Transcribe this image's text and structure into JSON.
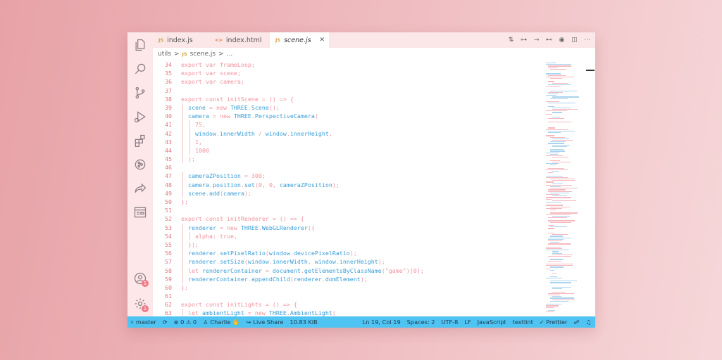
{
  "colors": {
    "accent_statusbar": "#4fc3f2",
    "line_numbers": "#e07a86",
    "keyword": "#f0929c",
    "identifier": "#3b9ed6",
    "activity_bar": "#fde7e9"
  },
  "tabs": [
    {
      "icon": "JS",
      "label": "index.js"
    },
    {
      "icon": "<>",
      "label": "index.html"
    },
    {
      "icon": "JS",
      "label": "scene.js",
      "close": "✕"
    }
  ],
  "breadcrumb": {
    "folder": "utils",
    "sep": ">",
    "icon": "JS",
    "file": "scene.js",
    "more": "..."
  },
  "activity_icons": [
    "files-icon",
    "search-icon",
    "source-control-icon",
    "run-debug-icon",
    "extensions-icon",
    "gitlens-icon",
    "live-share-icon",
    "panel-icon",
    "account-icon",
    "settings-icon"
  ],
  "account_badge": "1",
  "settings_badge": "1",
  "code_lines": [
    {
      "n": "34",
      "t": [
        [
          "k",
          "export var "
        ],
        [
          "n",
          "frameLoop"
        ],
        [
          "k",
          ";"
        ]
      ]
    },
    {
      "n": "35",
      "t": [
        [
          "k",
          "export var "
        ],
        [
          "n",
          "scene"
        ],
        [
          "k",
          ";"
        ]
      ]
    },
    {
      "n": "36",
      "t": [
        [
          "k",
          "export var "
        ],
        [
          "n",
          "camera"
        ],
        [
          "k",
          ";"
        ]
      ]
    },
    {
      "n": "37",
      "t": []
    },
    {
      "n": "38",
      "t": [
        [
          "k",
          "export const "
        ],
        [
          "n",
          "initScene"
        ],
        [
          "k",
          " = () => {"
        ]
      ]
    },
    {
      "n": "39",
      "t": [
        [
          "i",
          "  scene"
        ],
        [
          "k",
          " = new "
        ],
        [
          "i",
          "THREE"
        ],
        [
          "k",
          "."
        ],
        [
          "i",
          "Scene"
        ],
        [
          "k",
          "();"
        ]
      ]
    },
    {
      "n": "40",
      "t": [
        [
          "i",
          "  camera"
        ],
        [
          "k",
          " = new "
        ],
        [
          "i",
          "THREE"
        ],
        [
          "k",
          "."
        ],
        [
          "i",
          "PerspectiveCamera"
        ],
        [
          "k",
          "("
        ]
      ]
    },
    {
      "n": "41",
      "t": [
        [
          "n",
          "    75"
        ],
        [
          "k",
          ","
        ]
      ]
    },
    {
      "n": "42",
      "t": [
        [
          "i",
          "    window"
        ],
        [
          "k",
          "."
        ],
        [
          "i",
          "innerWidth"
        ],
        [
          "k",
          " / "
        ],
        [
          "i",
          "window"
        ],
        [
          "k",
          "."
        ],
        [
          "i",
          "innerHeight"
        ],
        [
          "k",
          ","
        ]
      ]
    },
    {
      "n": "43",
      "t": [
        [
          "n",
          "    1"
        ],
        [
          "k",
          ","
        ]
      ]
    },
    {
      "n": "44",
      "t": [
        [
          "n",
          "    1000"
        ]
      ]
    },
    {
      "n": "45",
      "t": [
        [
          "k",
          "  );"
        ]
      ]
    },
    {
      "n": "46",
      "t": []
    },
    {
      "n": "47",
      "t": [
        [
          "i",
          "  cameraZPosition"
        ],
        [
          "k",
          " = "
        ],
        [
          "n",
          "300"
        ],
        [
          "k",
          ";"
        ]
      ]
    },
    {
      "n": "48",
      "t": [
        [
          "i",
          "  camera"
        ],
        [
          "k",
          "."
        ],
        [
          "i",
          "position"
        ],
        [
          "k",
          "."
        ],
        [
          "i",
          "set"
        ],
        [
          "k",
          "("
        ],
        [
          "n",
          "0"
        ],
        [
          "k",
          ", "
        ],
        [
          "n",
          "0"
        ],
        [
          "k",
          ", "
        ],
        [
          "i",
          "cameraZPosition"
        ],
        [
          "k",
          ");"
        ]
      ]
    },
    {
      "n": "49",
      "t": [
        [
          "i",
          "  scene"
        ],
        [
          "k",
          "."
        ],
        [
          "i",
          "add"
        ],
        [
          "k",
          "("
        ],
        [
          "i",
          "camera"
        ],
        [
          "k",
          ");"
        ]
      ]
    },
    {
      "n": "50",
      "t": [
        [
          "k",
          "};"
        ]
      ]
    },
    {
      "n": "51",
      "t": []
    },
    {
      "n": "52",
      "t": [
        [
          "k",
          "export const "
        ],
        [
          "n",
          "initRenderer"
        ],
        [
          "k",
          " = () => {"
        ]
      ]
    },
    {
      "n": "53",
      "t": [
        [
          "i",
          "  renderer"
        ],
        [
          "k",
          " = new "
        ],
        [
          "i",
          "THREE"
        ],
        [
          "k",
          "."
        ],
        [
          "i",
          "WebGLRenderer"
        ],
        [
          "k",
          "({"
        ]
      ]
    },
    {
      "n": "54",
      "t": [
        [
          "n",
          "    alpha"
        ],
        [
          "k",
          ": "
        ],
        [
          "n",
          "true"
        ],
        [
          "k",
          ","
        ]
      ]
    },
    {
      "n": "55",
      "t": [
        [
          "k",
          "  });"
        ]
      ]
    },
    {
      "n": "56",
      "t": [
        [
          "i",
          "  renderer"
        ],
        [
          "k",
          "."
        ],
        [
          "i",
          "setPixelRatio"
        ],
        [
          "k",
          "("
        ],
        [
          "i",
          "window"
        ],
        [
          "k",
          "."
        ],
        [
          "i",
          "devicePixelRatio"
        ],
        [
          "k",
          ");"
        ]
      ]
    },
    {
      "n": "57",
      "t": [
        [
          "i",
          "  renderer"
        ],
        [
          "k",
          "."
        ],
        [
          "i",
          "setSize"
        ],
        [
          "k",
          "("
        ],
        [
          "i",
          "window"
        ],
        [
          "k",
          "."
        ],
        [
          "i",
          "innerWidth"
        ],
        [
          "k",
          ", "
        ],
        [
          "i",
          "window"
        ],
        [
          "k",
          "."
        ],
        [
          "i",
          "innerHeight"
        ],
        [
          "k",
          ");"
        ]
      ]
    },
    {
      "n": "58",
      "t": [
        [
          "k",
          "  let "
        ],
        [
          "i",
          "rendererContainer"
        ],
        [
          "k",
          " = "
        ],
        [
          "i",
          "document"
        ],
        [
          "k",
          "."
        ],
        [
          "i",
          "getElementsByClassName"
        ],
        [
          "k",
          "("
        ],
        [
          "s",
          "\"game\""
        ],
        [
          "k",
          ")["
        ],
        [
          "n",
          "0"
        ],
        [
          "k",
          "];"
        ]
      ]
    },
    {
      "n": "59",
      "t": [
        [
          "i",
          "  rendererContainer"
        ],
        [
          "k",
          "."
        ],
        [
          "i",
          "appendChild"
        ],
        [
          "k",
          "("
        ],
        [
          "i",
          "renderer"
        ],
        [
          "k",
          "."
        ],
        [
          "i",
          "domElement"
        ],
        [
          "k",
          ");"
        ]
      ]
    },
    {
      "n": "60",
      "t": [
        [
          "k",
          "};"
        ]
      ]
    },
    {
      "n": "61",
      "t": []
    },
    {
      "n": "62",
      "t": [
        [
          "k",
          "export const "
        ],
        [
          "n",
          "initLights"
        ],
        [
          "k",
          " = () => {"
        ]
      ]
    },
    {
      "n": "63",
      "t": [
        [
          "k",
          "  let "
        ],
        [
          "i",
          "ambientLight"
        ],
        [
          "k",
          " = new "
        ],
        [
          "i",
          "THREE"
        ],
        [
          "k",
          "."
        ],
        [
          "i",
          "AmbientLight"
        ],
        [
          "k",
          "("
        ]
      ]
    }
  ],
  "statusbar": {
    "branch": "master",
    "sync": "⟳",
    "problems": "⊗ 0 ⚠ 0",
    "user": "Charlie",
    "live_share": "Live Share",
    "file_size": "10.83 KiB",
    "cursor": "Ln 19, Col 19",
    "spaces": "Spaces: 2",
    "encoding": "UTF-8",
    "eol": "LF",
    "language": "JavaScript",
    "linter": "textlint",
    "formatter": "✓ Prettier"
  }
}
